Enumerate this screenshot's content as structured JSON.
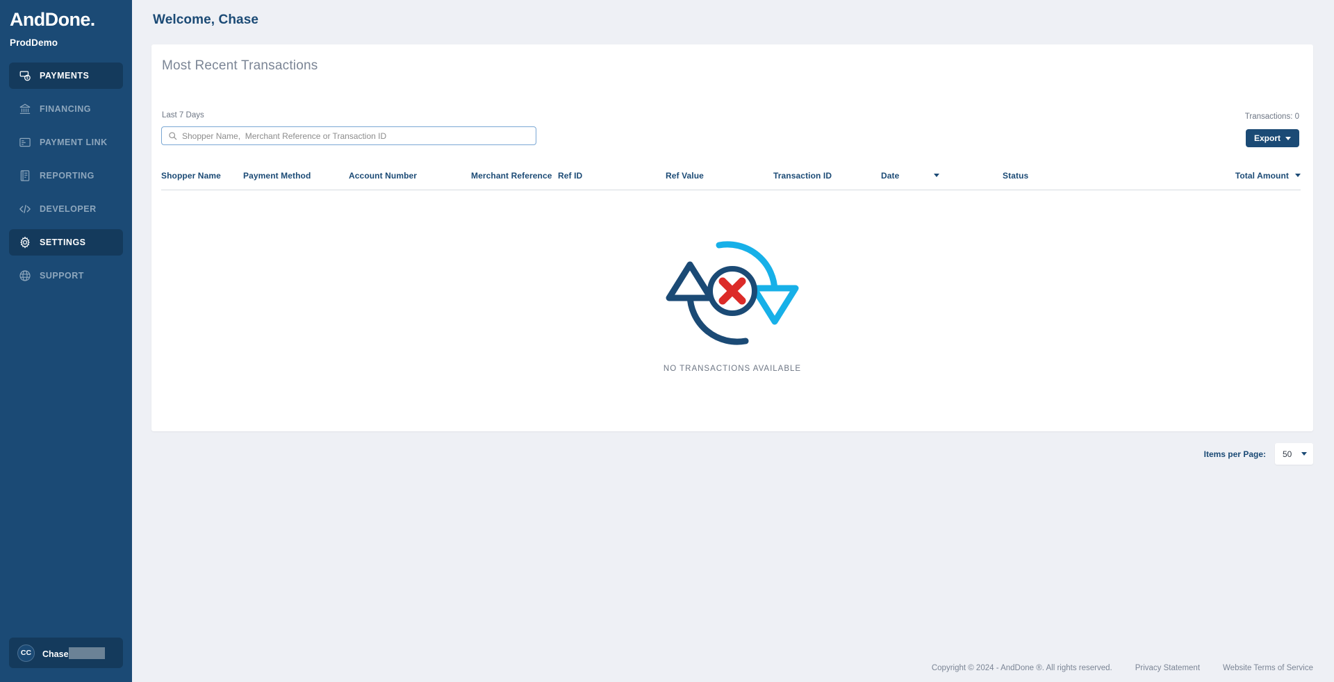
{
  "brand": {
    "logo": "AndDone",
    "logo_dot": ".",
    "environment": "ProdDemo"
  },
  "sidebar": {
    "items": [
      {
        "label": "PAYMENTS",
        "icon": "payments-icon",
        "active": true
      },
      {
        "label": "FINANCING",
        "icon": "bank-icon",
        "active": false
      },
      {
        "label": "PAYMENT LINK",
        "icon": "payment-link-icon",
        "active": false
      },
      {
        "label": "REPORTING",
        "icon": "report-icon",
        "active": false
      },
      {
        "label": "DEVELOPER",
        "icon": "code-icon",
        "active": false
      },
      {
        "label": "SETTINGS",
        "icon": "gear-icon",
        "active": true
      },
      {
        "label": "SUPPORT",
        "icon": "globe-icon",
        "active": false
      }
    ],
    "user": {
      "initials": "CC",
      "name": "Chase",
      "name_redacted": true
    }
  },
  "header": {
    "welcome": "Welcome, Chase"
  },
  "card": {
    "title": "Most Recent Transactions",
    "subtitle": "Last 7 Days",
    "transactions_count_label": "Transactions: 0",
    "export_label": "Export",
    "search": {
      "placeholder": "Shopper Name,  Merchant Reference or Transaction ID",
      "value": "",
      "icon": "search-icon"
    },
    "columns": [
      {
        "label": "Shopper Name",
        "sort": false
      },
      {
        "label": "Payment Method",
        "sort": false
      },
      {
        "label": "Account Number",
        "sort": false
      },
      {
        "label": "Merchant Reference",
        "sort": false
      },
      {
        "label": "Ref ID",
        "sort": false
      },
      {
        "label": "Ref Value",
        "sort": false
      },
      {
        "label": "Transaction ID",
        "sort": false
      },
      {
        "label": "Date",
        "sort": true
      },
      {
        "label": "Status",
        "sort": false
      },
      {
        "label": "Total Amount",
        "sort": true
      }
    ],
    "empty_state": {
      "text": "NO TRANSACTIONS AVAILABLE",
      "illustration": "no-transactions-icon"
    },
    "rows": []
  },
  "pagination": {
    "label": "Items per Page:",
    "value": "50"
  },
  "footer": {
    "copyright": "Copyright © 2024 - AndDone ®. All rights reserved.",
    "privacy_link": "Privacy Statement",
    "terms_link": "Website Terms of Service"
  },
  "colors": {
    "sidebar_bg": "#1b4a75",
    "sidebar_active": "#143a5c",
    "page_bg": "#eef0f5",
    "accent": "#1b4a75",
    "light_blue": "#17b0e8",
    "danger_red": "#dc2b28"
  }
}
